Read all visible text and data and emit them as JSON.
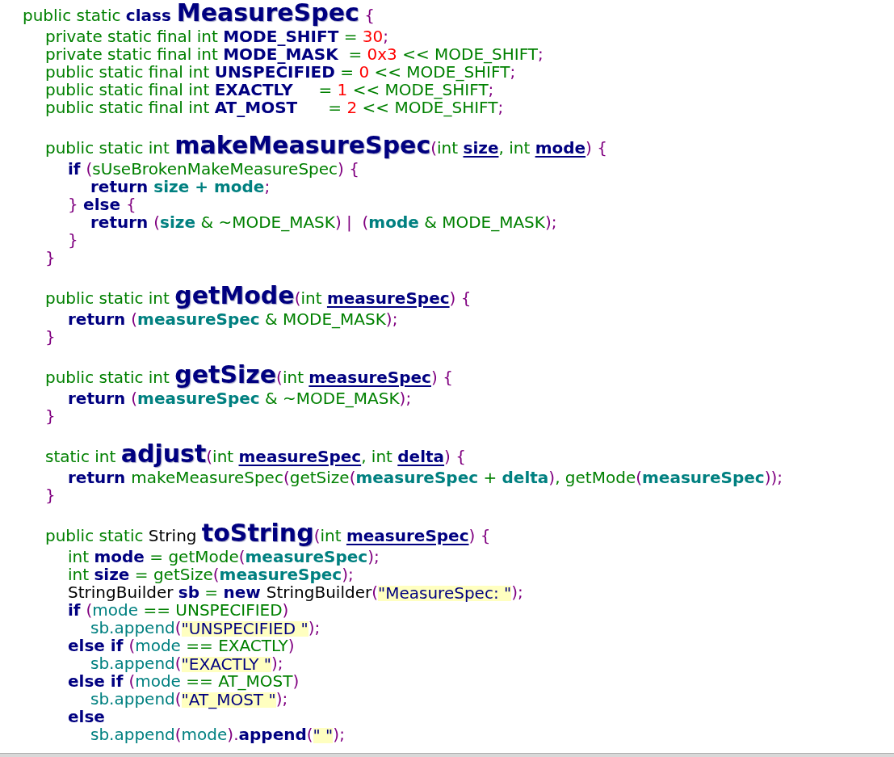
{
  "code": {
    "lines": [
      {
        "tokens": [
          {
            "kind": "keyword",
            "text": "public static "
          },
          {
            "kind": "bold",
            "text": "class "
          },
          {
            "kind": "title",
            "text": "MeasureSpec"
          },
          {
            "kind": "punct",
            "text": " {"
          }
        ],
        "children": [
          {
            "tokens": [
              {
                "kind": "keyword",
                "text": "private static final int "
              },
              {
                "kind": "bold",
                "text": "MODE_SHIFT"
              },
              {
                "kind": "keyword",
                "text": " = "
              },
              {
                "kind": "number",
                "text": "30"
              },
              {
                "kind": "punct",
                "text": ";"
              }
            ]
          },
          {
            "tokens": [
              {
                "kind": "keyword",
                "text": "private static final int "
              },
              {
                "kind": "bold",
                "text": "MODE_MASK"
              },
              {
                "kind": "keyword",
                "text": "  = "
              },
              {
                "kind": "number",
                "text": "0x3"
              },
              {
                "kind": "keyword",
                "text": " << MODE_SHIFT"
              },
              {
                "kind": "punct",
                "text": ";"
              }
            ]
          },
          {
            "tokens": [
              {
                "kind": "keyword",
                "text": "public static final int "
              },
              {
                "kind": "bold",
                "text": "UNSPECIFIED"
              },
              {
                "kind": "keyword",
                "text": " = "
              },
              {
                "kind": "number",
                "text": "0"
              },
              {
                "kind": "keyword",
                "text": " << MODE_SHIFT"
              },
              {
                "kind": "punct",
                "text": ";"
              }
            ]
          },
          {
            "tokens": [
              {
                "kind": "keyword",
                "text": "public static final int "
              },
              {
                "kind": "bold",
                "text": "EXACTLY"
              },
              {
                "kind": "keyword",
                "text": "     = "
              },
              {
                "kind": "number",
                "text": "1"
              },
              {
                "kind": "keyword",
                "text": " << MODE_SHIFT"
              },
              {
                "kind": "punct",
                "text": ";"
              }
            ]
          },
          {
            "tokens": [
              {
                "kind": "keyword",
                "text": "public static final int "
              },
              {
                "kind": "bold",
                "text": "AT_MOST"
              },
              {
                "kind": "keyword",
                "text": "      = "
              },
              {
                "kind": "number",
                "text": "2"
              },
              {
                "kind": "keyword",
                "text": " << MODE_SHIFT"
              },
              {
                "kind": "punct",
                "text": ";"
              }
            ]
          },
          {
            "gap_before": true,
            "tokens": [
              {
                "kind": "keyword",
                "text": "public static int "
              },
              {
                "kind": "title",
                "text": "makeMeasureSpec"
              },
              {
                "kind": "punct",
                "text": "("
              },
              {
                "kind": "keyword",
                "text": "int "
              },
              {
                "kind": "param",
                "text": "size"
              },
              {
                "kind": "keyword",
                "text": ", int "
              },
              {
                "kind": "param",
                "text": "mode"
              },
              {
                "kind": "punct",
                "text": ") {"
              }
            ],
            "children": [
              {
                "tokens": [
                  {
                    "kind": "bold",
                    "text": "if "
                  },
                  {
                    "kind": "punct",
                    "text": "("
                  },
                  {
                    "kind": "keyword",
                    "text": "sUseBrokenMakeMeasureSpec"
                  },
                  {
                    "kind": "punct",
                    "text": ") {"
                  }
                ],
                "children": [
                  {
                    "tokens": [
                      {
                        "kind": "bold",
                        "text": "return "
                      },
                      {
                        "kind": "variable",
                        "text": "size"
                      },
                      {
                        "kind": "variable",
                        "text": " + "
                      },
                      {
                        "kind": "variable",
                        "text": "mode"
                      },
                      {
                        "kind": "punct",
                        "text": ";"
                      }
                    ]
                  }
                ]
              },
              {
                "tokens": [
                  {
                    "kind": "punct",
                    "text": "} "
                  },
                  {
                    "kind": "bold",
                    "text": "else "
                  },
                  {
                    "kind": "punct",
                    "text": "{"
                  }
                ],
                "children": [
                  {
                    "tokens": [
                      {
                        "kind": "bold",
                        "text": "return "
                      },
                      {
                        "kind": "punct",
                        "text": "("
                      },
                      {
                        "kind": "variable",
                        "text": "size"
                      },
                      {
                        "kind": "keyword",
                        "text": " & ~MODE_MASK"
                      },
                      {
                        "kind": "punct",
                        "text": ") |  ("
                      },
                      {
                        "kind": "variable",
                        "text": "mode"
                      },
                      {
                        "kind": "keyword",
                        "text": " & MODE_MASK"
                      },
                      {
                        "kind": "punct",
                        "text": ");"
                      }
                    ]
                  }
                ]
              },
              {
                "tokens": [
                  {
                    "kind": "punct",
                    "text": "}"
                  }
                ]
              }
            ]
          },
          {
            "tokens": [
              {
                "kind": "punct",
                "text": "}"
              }
            ]
          },
          {
            "gap_before": true,
            "tokens": [
              {
                "kind": "keyword",
                "text": "public static int "
              },
              {
                "kind": "title",
                "text": "getMode"
              },
              {
                "kind": "punct",
                "text": "("
              },
              {
                "kind": "keyword",
                "text": "int "
              },
              {
                "kind": "param",
                "text": "measureSpec"
              },
              {
                "kind": "punct",
                "text": ") {"
              }
            ],
            "children": [
              {
                "tokens": [
                  {
                    "kind": "bold",
                    "text": "return "
                  },
                  {
                    "kind": "punct",
                    "text": "("
                  },
                  {
                    "kind": "variable",
                    "text": "measureSpec"
                  },
                  {
                    "kind": "keyword",
                    "text": " & MODE_MASK"
                  },
                  {
                    "kind": "punct",
                    "text": ");"
                  }
                ]
              }
            ]
          },
          {
            "tokens": [
              {
                "kind": "punct",
                "text": "}"
              }
            ]
          },
          {
            "gap_before": true,
            "tokens": [
              {
                "kind": "keyword",
                "text": "public static int "
              },
              {
                "kind": "title",
                "text": "getSize"
              },
              {
                "kind": "punct",
                "text": "("
              },
              {
                "kind": "keyword",
                "text": "int "
              },
              {
                "kind": "param",
                "text": "measureSpec"
              },
              {
                "kind": "punct",
                "text": ") {"
              }
            ],
            "children": [
              {
                "tokens": [
                  {
                    "kind": "bold",
                    "text": "return "
                  },
                  {
                    "kind": "punct",
                    "text": "("
                  },
                  {
                    "kind": "variable",
                    "text": "measureSpec"
                  },
                  {
                    "kind": "keyword",
                    "text": " & ~MODE_MASK"
                  },
                  {
                    "kind": "punct",
                    "text": ");"
                  }
                ]
              }
            ]
          },
          {
            "tokens": [
              {
                "kind": "punct",
                "text": "}"
              }
            ]
          },
          {
            "gap_before": true,
            "tokens": [
              {
                "kind": "keyword",
                "text": "static int "
              },
              {
                "kind": "title",
                "text": "adjust"
              },
              {
                "kind": "punct",
                "text": "("
              },
              {
                "kind": "keyword",
                "text": "int "
              },
              {
                "kind": "param",
                "text": "measureSpec"
              },
              {
                "kind": "keyword",
                "text": ", int "
              },
              {
                "kind": "param",
                "text": "delta"
              },
              {
                "kind": "punct",
                "text": ") {"
              }
            ],
            "children": [
              {
                "tokens": [
                  {
                    "kind": "bold",
                    "text": "return "
                  },
                  {
                    "kind": "keyword",
                    "text": "makeMeasureSpec"
                  },
                  {
                    "kind": "punct",
                    "text": "("
                  },
                  {
                    "kind": "keyword",
                    "text": "getSize"
                  },
                  {
                    "kind": "punct",
                    "text": "("
                  },
                  {
                    "kind": "variable",
                    "text": "measureSpec"
                  },
                  {
                    "kind": "keyword",
                    "text": " + "
                  },
                  {
                    "kind": "variable",
                    "text": "delta"
                  },
                  {
                    "kind": "punct",
                    "text": ")"
                  },
                  {
                    "kind": "keyword",
                    "text": ", getMode"
                  },
                  {
                    "kind": "punct",
                    "text": "("
                  },
                  {
                    "kind": "variable",
                    "text": "measureSpec"
                  },
                  {
                    "kind": "punct",
                    "text": "));"
                  }
                ]
              }
            ]
          },
          {
            "tokens": [
              {
                "kind": "punct",
                "text": "}"
              }
            ]
          },
          {
            "gap_before": true,
            "tokens": [
              {
                "kind": "keyword",
                "text": "public static "
              },
              {
                "kind": "plain",
                "text": "String "
              },
              {
                "kind": "title",
                "text": "toString"
              },
              {
                "kind": "punct",
                "text": "("
              },
              {
                "kind": "keyword",
                "text": "int "
              },
              {
                "kind": "param",
                "text": "measureSpec"
              },
              {
                "kind": "punct",
                "text": ") {"
              }
            ],
            "children": [
              {
                "tokens": [
                  {
                    "kind": "keyword",
                    "text": "int "
                  },
                  {
                    "kind": "bold",
                    "text": "mode"
                  },
                  {
                    "kind": "keyword",
                    "text": " = getMode"
                  },
                  {
                    "kind": "punct",
                    "text": "("
                  },
                  {
                    "kind": "variable",
                    "text": "measureSpec"
                  },
                  {
                    "kind": "punct",
                    "text": ");"
                  }
                ]
              },
              {
                "tokens": [
                  {
                    "kind": "keyword",
                    "text": "int "
                  },
                  {
                    "kind": "bold",
                    "text": "size"
                  },
                  {
                    "kind": "keyword",
                    "text": " = getSize"
                  },
                  {
                    "kind": "punct",
                    "text": "("
                  },
                  {
                    "kind": "variable",
                    "text": "measureSpec"
                  },
                  {
                    "kind": "punct",
                    "text": ");"
                  }
                ]
              },
              {
                "tokens": [
                  {
                    "kind": "plain",
                    "text": "StringBuilder "
                  },
                  {
                    "kind": "bold",
                    "text": "sb"
                  },
                  {
                    "kind": "keyword",
                    "text": " = "
                  },
                  {
                    "kind": "bold",
                    "text": "new "
                  },
                  {
                    "kind": "plain",
                    "text": "StringBuilder"
                  },
                  {
                    "kind": "punct",
                    "text": "("
                  },
                  {
                    "kind": "string",
                    "text": "\"MeasureSpec: \""
                  },
                  {
                    "kind": "punct",
                    "text": ");"
                  }
                ]
              },
              {
                "tokens": [
                  {
                    "kind": "bold",
                    "text": "if "
                  },
                  {
                    "kind": "punct",
                    "text": "("
                  },
                  {
                    "kind": "field",
                    "text": "mode"
                  },
                  {
                    "kind": "keyword",
                    "text": " == UNSPECIFIED"
                  },
                  {
                    "kind": "punct",
                    "text": ")"
                  }
                ],
                "children": [
                  {
                    "tokens": [
                      {
                        "kind": "field",
                        "text": "sb.append"
                      },
                      {
                        "kind": "punct",
                        "text": "("
                      },
                      {
                        "kind": "string",
                        "text": "\"UNSPECIFIED \""
                      },
                      {
                        "kind": "punct",
                        "text": ");"
                      }
                    ]
                  }
                ]
              },
              {
                "tokens": [
                  {
                    "kind": "bold",
                    "text": "else if "
                  },
                  {
                    "kind": "punct",
                    "text": "("
                  },
                  {
                    "kind": "field",
                    "text": "mode"
                  },
                  {
                    "kind": "keyword",
                    "text": " == EXACTLY"
                  },
                  {
                    "kind": "punct",
                    "text": ")"
                  }
                ],
                "children": [
                  {
                    "tokens": [
                      {
                        "kind": "field",
                        "text": "sb.append"
                      },
                      {
                        "kind": "punct",
                        "text": "("
                      },
                      {
                        "kind": "string",
                        "text": "\"EXACTLY \""
                      },
                      {
                        "kind": "punct",
                        "text": ");"
                      }
                    ]
                  }
                ]
              },
              {
                "tokens": [
                  {
                    "kind": "bold",
                    "text": "else if "
                  },
                  {
                    "kind": "punct",
                    "text": "("
                  },
                  {
                    "kind": "field",
                    "text": "mode"
                  },
                  {
                    "kind": "keyword",
                    "text": " == AT_MOST"
                  },
                  {
                    "kind": "punct",
                    "text": ")"
                  }
                ],
                "children": [
                  {
                    "tokens": [
                      {
                        "kind": "field",
                        "text": "sb.append"
                      },
                      {
                        "kind": "punct",
                        "text": "("
                      },
                      {
                        "kind": "string",
                        "text": "\"AT_MOST \""
                      },
                      {
                        "kind": "punct",
                        "text": ");"
                      }
                    ]
                  }
                ]
              },
              {
                "tokens": [
                  {
                    "kind": "bold",
                    "text": "else"
                  }
                ],
                "children": [
                  {
                    "tokens": [
                      {
                        "kind": "field",
                        "text": "sb.append"
                      },
                      {
                        "kind": "punct",
                        "text": "("
                      },
                      {
                        "kind": "field",
                        "text": "mode"
                      },
                      {
                        "kind": "punct",
                        "text": ")."
                      },
                      {
                        "kind": "bold",
                        "text": "append"
                      },
                      {
                        "kind": "punct",
                        "text": "("
                      },
                      {
                        "kind": "string",
                        "text": "\" \""
                      },
                      {
                        "kind": "punct",
                        "text": ");"
                      }
                    ]
                  }
                ]
              }
            ]
          }
        ]
      }
    ]
  }
}
